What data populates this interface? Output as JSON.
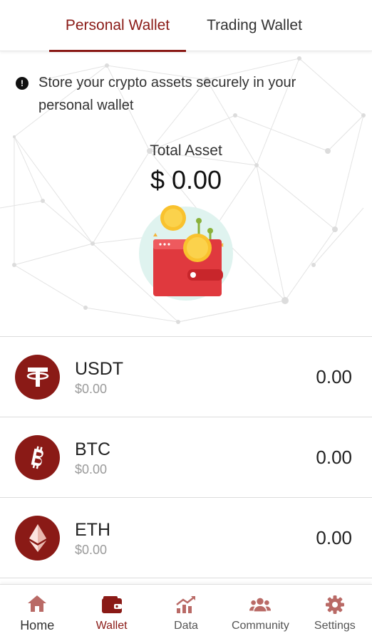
{
  "tabs": [
    {
      "label": "Personal Wallet",
      "active": true
    },
    {
      "label": "Trading Wallet",
      "active": false
    }
  ],
  "notice": {
    "icon": "info-icon",
    "text": "Store your crypto assets securely in your personal wallet"
  },
  "total": {
    "label": "Total Asset",
    "value": "$ 0.00"
  },
  "assets": [
    {
      "symbol": "USDT",
      "usd": "$0.00",
      "amount": "0.00",
      "icon": "tether-icon"
    },
    {
      "symbol": "BTC",
      "usd": "$0.00",
      "amount": "0.00",
      "icon": "bitcoin-icon"
    },
    {
      "symbol": "ETH",
      "usd": "$0.00",
      "amount": "0.00",
      "icon": "ethereum-icon"
    }
  ],
  "nav": [
    {
      "label": "Home",
      "icon": "home-icon"
    },
    {
      "label": "Wallet",
      "icon": "wallet-icon",
      "active": true
    },
    {
      "label": "Data",
      "icon": "chart-icon"
    },
    {
      "label": "Community",
      "icon": "community-icon"
    },
    {
      "label": "Settings",
      "icon": "gear-icon"
    }
  ],
  "colors": {
    "accent": "#8a1a16",
    "muted": "#9a9a9a",
    "wallet_red": "#e0393e",
    "coin_gold": "#f9c22e",
    "circle_mint": "#dff3ef"
  }
}
